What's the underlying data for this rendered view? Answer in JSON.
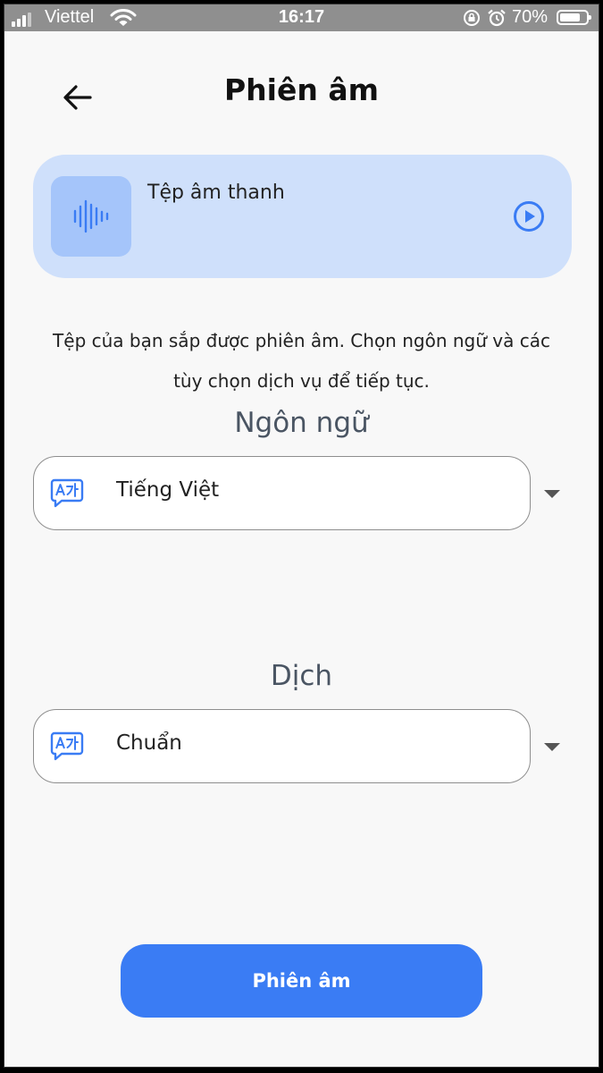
{
  "status_bar": {
    "carrier": "Viettel",
    "time": "16:17",
    "battery_percent": "70%",
    "battery_level": 0.7
  },
  "header": {
    "back_icon": "arrow-left-icon",
    "title": "Phiên âm"
  },
  "audio_card": {
    "label": "Tệp âm thanh",
    "wave_icon": "waveform-icon",
    "play_icon": "play-circle-icon"
  },
  "description": "Tệp của bạn sắp được phiên âm. Chọn ngôn ngữ và các tùy chọn dịch vụ để tiếp tục.",
  "language": {
    "label": "Ngôn ngữ",
    "selected": "Tiếng Việt",
    "icon": "translate-icon"
  },
  "translation": {
    "label": "Dịch",
    "selected": "Chuẩn",
    "icon": "translate-icon"
  },
  "submit_button": "Phiên âm",
  "colors": {
    "accent": "#3a7cf4",
    "card_background": "#cfe0fb",
    "wave_box": "#a5c5fa",
    "status_bar": "#8f8f8f"
  }
}
